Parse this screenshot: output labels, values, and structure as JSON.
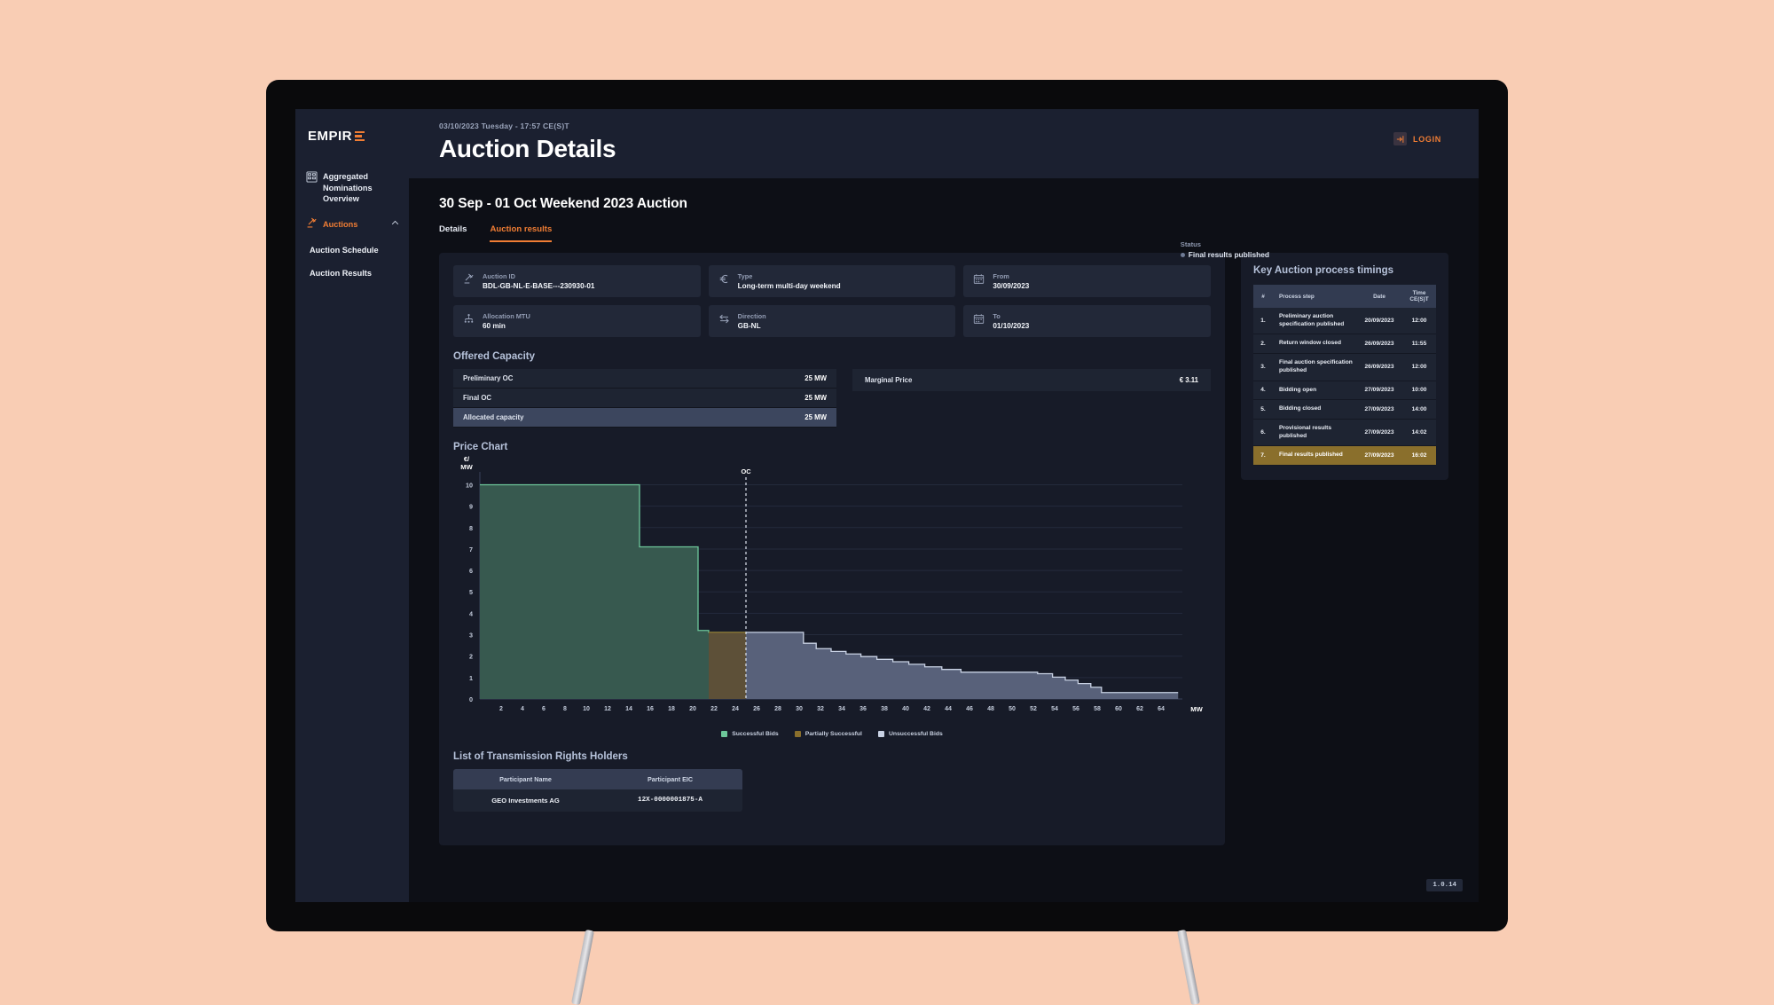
{
  "sidebar": {
    "logo": "EMPIR",
    "items": [
      {
        "label": "Aggregated Nominations Overview",
        "icon": "grid-icon"
      },
      {
        "label": "Auctions",
        "icon": "gavel-icon",
        "chevron": "chevron-up-icon"
      }
    ],
    "sub_items": [
      {
        "label": "Auction Schedule"
      },
      {
        "label": "Auction Results"
      }
    ]
  },
  "header": {
    "datetime": "03/10/2023 Tuesday - 17:57 CE(S)T",
    "title": "Auction Details",
    "login_label": "LOGIN"
  },
  "page": {
    "auction_title": "30 Sep - 01 Oct Weekend 2023 Auction",
    "tabs": [
      {
        "label": "Details",
        "active": false
      },
      {
        "label": "Auction results",
        "active": true
      }
    ],
    "status_label": "Status",
    "status_value": "Final results published",
    "version": "1.0.14"
  },
  "info_cards": [
    {
      "label": "Auction ID",
      "value": "BDL-GB-NL-E-BASE---230930-01",
      "icon": "gavel-icon"
    },
    {
      "label": "Type",
      "value": "Long-term multi-day weekend",
      "icon": "euro-icon"
    },
    {
      "label": "From",
      "value": "30/09/2023",
      "icon": "calendar-icon"
    },
    {
      "label": "Allocation MTU",
      "value": "60 min",
      "icon": "mtu-icon"
    },
    {
      "label": "Direction",
      "value": "GB-NL",
      "icon": "arrows-icon"
    },
    {
      "label": "To",
      "value": "01/10/2023",
      "icon": "calendar-icon"
    }
  ],
  "offered_capacity": {
    "title": "Offered Capacity",
    "rows": [
      {
        "label": "Preliminary OC",
        "value": "25 MW",
        "highlight": false
      },
      {
        "label": "Final OC",
        "value": "25 MW",
        "highlight": false
      },
      {
        "label": "Allocated capacity",
        "value": "25 MW",
        "highlight": true
      }
    ],
    "marginal_price_label": "Marginal Price",
    "marginal_price_value": "€ 3.11"
  },
  "price_chart": {
    "title": "Price Chart"
  },
  "chart_data": {
    "type": "area",
    "title": "Price Chart",
    "xlabel": "MW",
    "ylabel": "€/ MW",
    "xlim": [
      0,
      66
    ],
    "ylim": [
      0,
      10.6
    ],
    "grid": true,
    "xticks": [
      2,
      4,
      6,
      8,
      10,
      12,
      14,
      16,
      18,
      20,
      22,
      24,
      26,
      28,
      30,
      32,
      34,
      36,
      38,
      40,
      42,
      44,
      46,
      48,
      50,
      52,
      54,
      56,
      58,
      60,
      62,
      64
    ],
    "yticks": [
      0,
      1,
      2,
      3,
      4,
      5,
      6,
      7,
      8,
      9,
      10
    ],
    "annotation": {
      "label": "OC",
      "x": 25,
      "style": "dashed-vertical"
    },
    "legend_position": "bottom",
    "legend": [
      {
        "name": "Successful Bids",
        "color": "#6dc79a"
      },
      {
        "name": "Partially Successful",
        "color": "#8a6f2c"
      },
      {
        "name": "Unsuccessful Bids",
        "color": "#c9d2e4"
      }
    ],
    "series": [
      {
        "name": "Successful Bids",
        "color": "#6dc79a",
        "fill": "#37594f",
        "steps": [
          {
            "x0": 0,
            "x1": 15,
            "y": 10.0
          },
          {
            "x0": 15,
            "x1": 20.5,
            "y": 7.1
          },
          {
            "x0": 20.5,
            "x1": 21.5,
            "y": 3.2
          },
          {
            "x0": 21.5,
            "x1": 25,
            "y": 3.11
          }
        ]
      },
      {
        "name": "Partially Successful",
        "color": "#8a6f2c",
        "fill": "#5d5038",
        "steps": [
          {
            "x0": 21.5,
            "x1": 25,
            "y": 3.11
          }
        ]
      },
      {
        "name": "Unsuccessful Bids",
        "color": "#c9d2e4",
        "fill": "#58617a",
        "steps": [
          {
            "x0": 25,
            "x1": 30.4,
            "y": 3.11
          },
          {
            "x0": 30.4,
            "x1": 31.6,
            "y": 2.6
          },
          {
            "x0": 31.6,
            "x1": 33.0,
            "y": 2.35
          },
          {
            "x0": 33.0,
            "x1": 34.4,
            "y": 2.22
          },
          {
            "x0": 34.4,
            "x1": 35.8,
            "y": 2.1
          },
          {
            "x0": 35.8,
            "x1": 37.3,
            "y": 1.98
          },
          {
            "x0": 37.3,
            "x1": 38.8,
            "y": 1.85
          },
          {
            "x0": 38.8,
            "x1": 40.3,
            "y": 1.74
          },
          {
            "x0": 40.3,
            "x1": 41.8,
            "y": 1.62
          },
          {
            "x0": 41.8,
            "x1": 43.4,
            "y": 1.5
          },
          {
            "x0": 43.4,
            "x1": 45.2,
            "y": 1.38
          },
          {
            "x0": 45.2,
            "x1": 52.4,
            "y": 1.25
          },
          {
            "x0": 52.4,
            "x1": 53.8,
            "y": 1.18
          },
          {
            "x0": 53.8,
            "x1": 55.0,
            "y": 1.02
          },
          {
            "x0": 55.0,
            "x1": 56.2,
            "y": 0.88
          },
          {
            "x0": 56.2,
            "x1": 57.4,
            "y": 0.72
          },
          {
            "x0": 57.4,
            "x1": 58.4,
            "y": 0.55
          },
          {
            "x0": 58.4,
            "x1": 65.6,
            "y": 0.3
          }
        ]
      }
    ]
  },
  "holders": {
    "title": "List of Transmission Rights Holders",
    "columns": [
      "Participant Name",
      "Participant EIC"
    ],
    "rows": [
      {
        "name": "GEO Investments AG",
        "eic": "12X-0000001875-A"
      }
    ]
  },
  "timings": {
    "title": "Key Auction process timings",
    "columns": [
      "#",
      "Process step",
      "Date",
      "Time CE(S)T"
    ],
    "rows": [
      {
        "n": "1.",
        "step": "Preliminary auction specification published",
        "date": "20/09/2023",
        "time": "12:00",
        "final": false
      },
      {
        "n": "2.",
        "step": "Return window closed",
        "date": "26/09/2023",
        "time": "11:55",
        "final": false
      },
      {
        "n": "3.",
        "step": "Final auction specification published",
        "date": "26/09/2023",
        "time": "12:00",
        "final": false
      },
      {
        "n": "4.",
        "step": "Bidding open",
        "date": "27/09/2023",
        "time": "10:00",
        "final": false
      },
      {
        "n": "5.",
        "step": "Bidding closed",
        "date": "27/09/2023",
        "time": "14:00",
        "final": false
      },
      {
        "n": "6.",
        "step": "Provisional results published",
        "date": "27/09/2023",
        "time": "14:02",
        "final": false
      },
      {
        "n": "7.",
        "step": "Final results published",
        "date": "27/09/2023",
        "time": "16:02",
        "final": true
      }
    ]
  },
  "colors": {
    "accent": "#f07d34",
    "page_bg": "#f9cdb4",
    "app_bg": "#0d0f16",
    "panel": "#171b28",
    "card": "#222838",
    "highlight_row": "#3c465e",
    "final_row": "#8a6f2c"
  }
}
